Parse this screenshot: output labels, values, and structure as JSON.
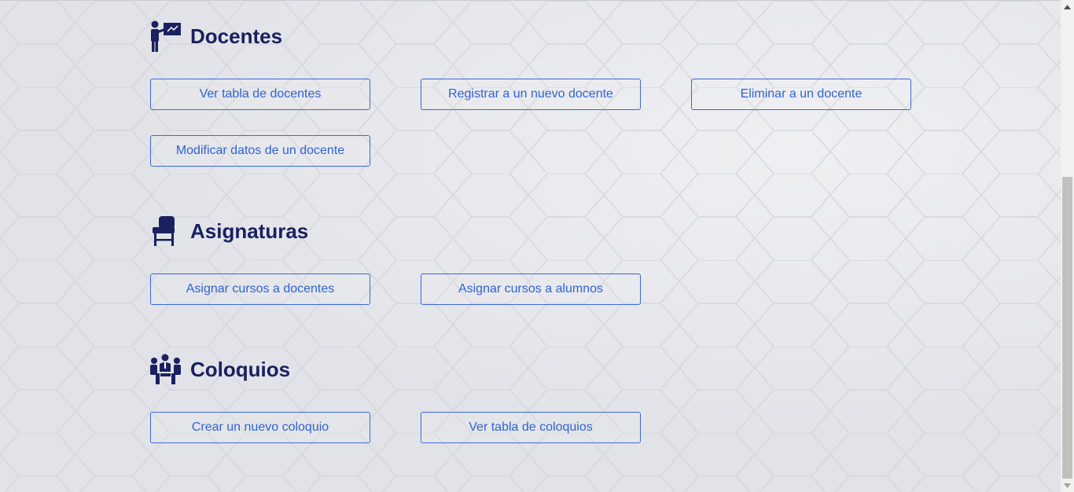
{
  "colors": {
    "heading": "#1a2060",
    "button_border": "#3a68d8",
    "button_text": "#2f62d6",
    "background": "#e2e3e8"
  },
  "sections": {
    "docentes": {
      "title": "Docentes",
      "icon": "teacher-board-icon",
      "buttons": {
        "ver_tabla": "Ver tabla de docentes",
        "registrar": "Registrar a un nuevo docente",
        "eliminar": "Eliminar a un docente",
        "modificar": "Modificar datos de un docente"
      }
    },
    "asignaturas": {
      "title": "Asignaturas",
      "icon": "school-desk-icon",
      "buttons": {
        "asignar_docentes": "Asignar cursos a docentes",
        "asignar_alumnos": "Asignar cursos a alumnos"
      }
    },
    "coloquios": {
      "title": "Coloquios",
      "icon": "meeting-group-icon",
      "buttons": {
        "crear": "Crear un nuevo coloquio",
        "ver_tabla": "Ver tabla de coloquios"
      }
    }
  },
  "scrollbar": {
    "up_icon": "scroll-up-arrow-icon",
    "down_icon": "scroll-down-arrow-icon"
  }
}
